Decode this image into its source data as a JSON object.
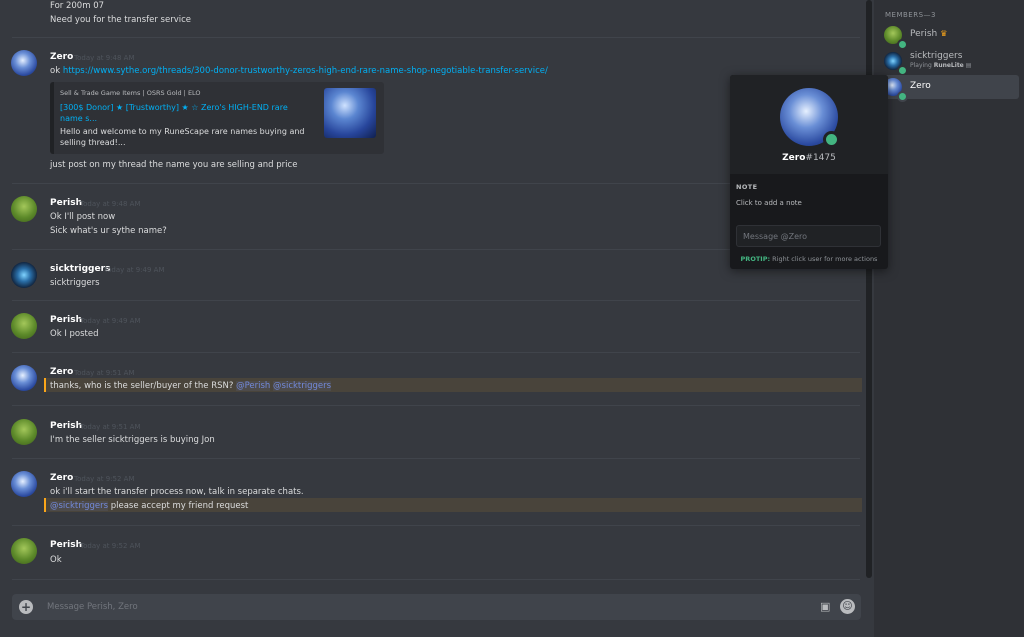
{
  "chat": {
    "top_lines": [
      "For 200m 07",
      "Need you for the transfer service"
    ],
    "messages": [
      {
        "author": "Zero",
        "time": "Today at 9:48 AM",
        "lines": [
          "just post on my thread the name you are selling and price"
        ],
        "link_prefix": "ok ",
        "link": "https://www.sythe.org/threads/300-donor-trustworthy-zeros-high-end-rare-name-shop-negotiable-transfer-service/"
      },
      {
        "author": "Perish",
        "time": "Today at 9:48 AM",
        "lines": [
          "Ok I'll post now",
          "Sick what's ur sythe name?"
        ]
      },
      {
        "author": "sicktriggers",
        "time": "Today at 9:49 AM",
        "lines": [
          "sicktriggers"
        ]
      },
      {
        "author": "Perish",
        "time": "Today at 9:49 AM",
        "lines": [
          "Ok I posted"
        ]
      },
      {
        "author": "Zero",
        "time": "Today at 9:51 AM",
        "text": "thanks, who is the seller/buyer of the RSN? ",
        "mentions": [
          "@Perish",
          "@sicktriggers"
        ]
      },
      {
        "author": "Perish",
        "time": "Today at 9:51 AM",
        "lines": [
          "I'm the seller sicktriggers is buying Jon"
        ]
      },
      {
        "author": "Zero",
        "time": "Today at 9:52 AM",
        "lines": [
          "ok i'll start the transfer process now, talk in separate chats."
        ],
        "mention2": "@sicktriggers",
        "text2": " please accept my friend request"
      },
      {
        "author": "Perish",
        "time": "Today at 9:52 AM",
        "lines": [
          "Ok"
        ]
      }
    ],
    "embed": {
      "provider": "Sell & Trade Game Items | OSRS Gold | ELO",
      "title": "[300$ Donor] ★ [Trustworthy] ★ ☆ Zero's HIGH-END rare name s...",
      "description": "Hello and welcome to my RuneScape rare names buying and selling thread!..."
    },
    "input_placeholder": "Message Perish, Zero"
  },
  "members": {
    "header": "MEMBERS—3",
    "list": [
      {
        "name": "Perish"
      },
      {
        "name": "sicktriggers",
        "activity_prefix": "Playing ",
        "activity": "RuneLite"
      },
      {
        "name": "Zero"
      }
    ]
  },
  "popout": {
    "username": "Zero",
    "discriminator": "#1475",
    "note_header": "NOTE",
    "note_placeholder": "Click to add a note",
    "message_placeholder": "Message @Zero",
    "protip_label": "PROTIP:",
    "protip_text": " Right click user for more actions"
  },
  "icons": {
    "plus": "plus-circle-icon",
    "gift": "gift-icon",
    "emoji": "emoji-icon",
    "crown": "crown-icon"
  },
  "colors": {
    "background": "#36393f",
    "sidebar": "#2f3136",
    "link": "#00b0f4",
    "mention": "#7289da",
    "online": "#43b581",
    "highlight": "#faa61a"
  }
}
